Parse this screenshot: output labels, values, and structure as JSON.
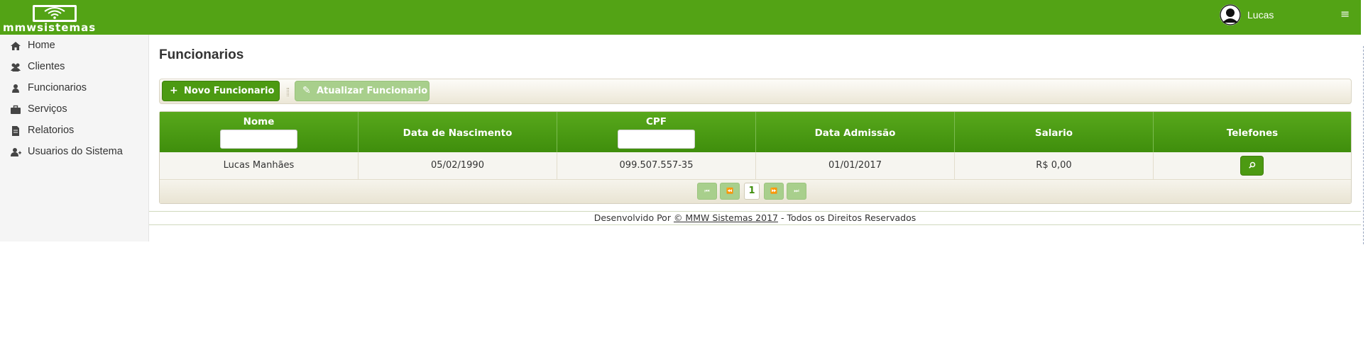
{
  "brand": {
    "logo_text": "mmwsistemas",
    "color": "#53a315"
  },
  "user": {
    "name": "Lucas",
    "avatar_icon": "user-avatar-icon"
  },
  "header": {
    "menu_icon": "≡"
  },
  "sidebar": {
    "items": [
      {
        "label": "Home",
        "icon": "home-icon"
      },
      {
        "label": "Clientes",
        "icon": "users-icon"
      },
      {
        "label": "Funcionarios",
        "icon": "user-icon"
      },
      {
        "label": "Serviços",
        "icon": "briefcase-icon"
      },
      {
        "label": "Relatorios",
        "icon": "file-icon"
      },
      {
        "label": "Usuarios do Sistema",
        "icon": "user-plus-icon"
      }
    ]
  },
  "main": {
    "title": "Funcionarios",
    "toolbar": {
      "new_icon": "+",
      "new_label": "Novo Funcionario",
      "update_icon": "✎",
      "update_label": "Atualizar Funcionario"
    },
    "table": {
      "columns": [
        "Nome",
        "Data de Nascimento",
        "CPF",
        "Data Admissão",
        "Salario",
        "Telefones"
      ],
      "filters": {
        "nome": "",
        "cpf": ""
      },
      "rows": [
        {
          "nome": "Lucas Manhães",
          "nascimento": "05/02/1990",
          "cpf": "099.507.557-35",
          "admissao": "01/01/2017",
          "salario": "R$ 0,00"
        }
      ],
      "pager": {
        "first": "⏮",
        "prev": "⏪",
        "current": "1",
        "next": "⏩",
        "last": "⏭"
      }
    }
  },
  "footer": {
    "prefix": "Desenvolvido Por ",
    "link": "© MMW Sistemas 2017",
    "suffix": " - Todos os Direitos Reservados"
  }
}
